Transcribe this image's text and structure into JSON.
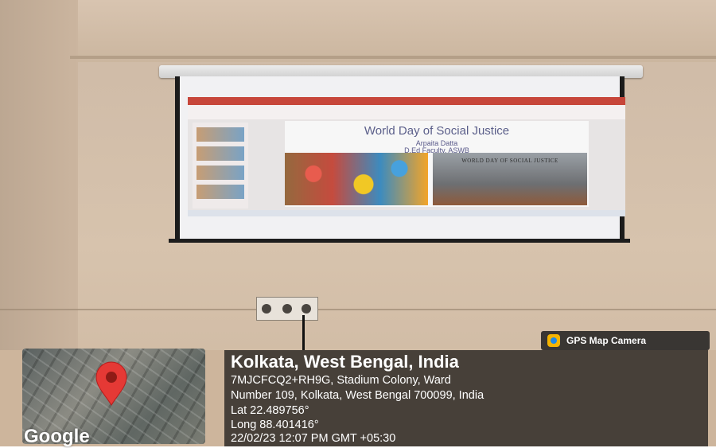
{
  "slide": {
    "title": "World Day of Social Justice",
    "presenter": "Arpaita Datta",
    "role": "D.Ed Faculty, ASWB",
    "photo_caption": "WORLD DAY OF SOCIAL JUSTICE"
  },
  "gps_overlay": {
    "app_badge": "GPS Map Camera",
    "map_brand": "Google",
    "city": "Kolkata, West Bengal, India",
    "address_line1": "7MJCFCQ2+RH9G, Stadium Colony, Ward",
    "address_line2": "Number 109, Kolkata, West Bengal 700099, India",
    "latitude": "Lat 22.489756°",
    "longitude": "Long 88.401416°",
    "timestamp": "22/02/23 12:07 PM GMT +05:30",
    "icons": {
      "badge": "gps-camera-icon",
      "pin": "map-pin-icon"
    },
    "colors": {
      "pin": "#e53935",
      "panel": "#141414"
    }
  }
}
